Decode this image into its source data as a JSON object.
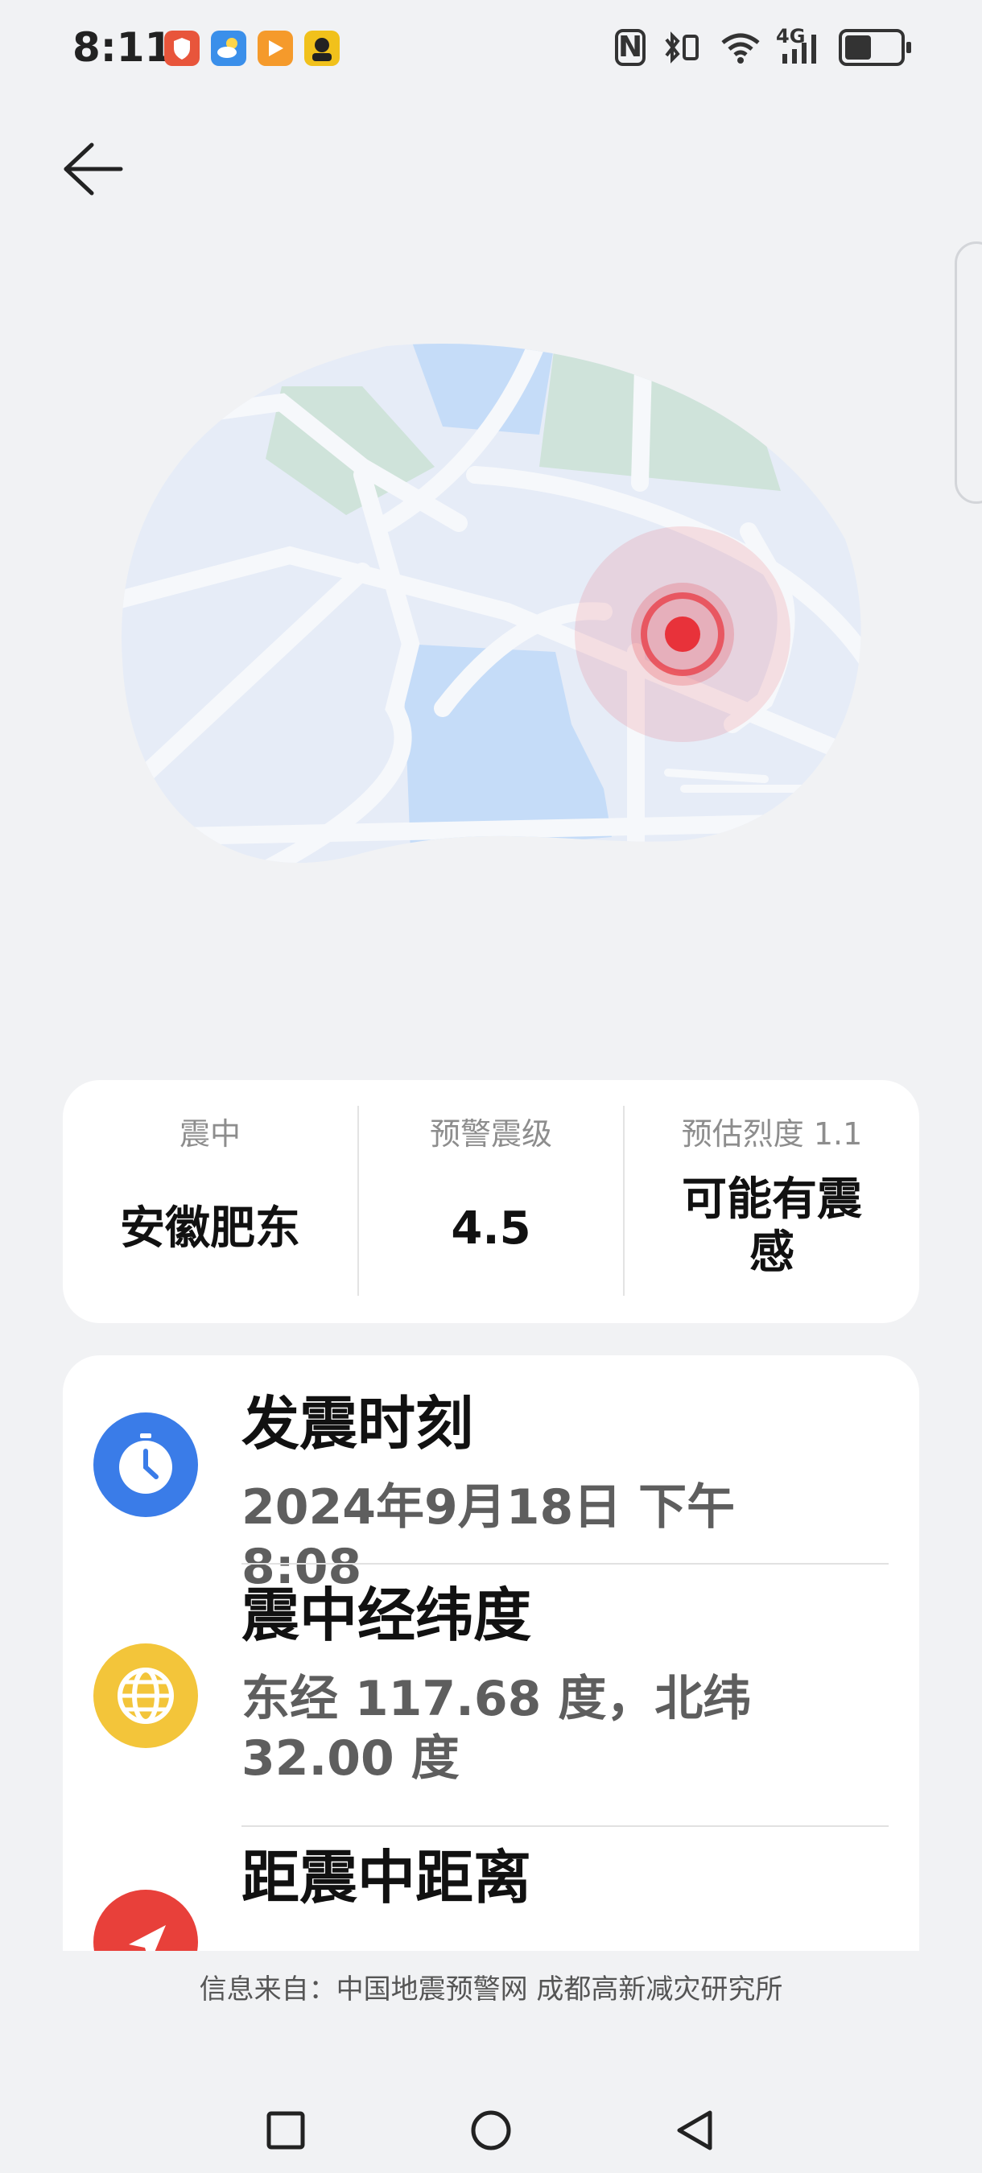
{
  "status_bar": {
    "time": "8:11",
    "app_icons": [
      {
        "name": "shield-app-icon",
        "color": "#e8553b"
      },
      {
        "name": "weather-app-icon",
        "color": "#3a8fea"
      },
      {
        "name": "video-app-icon",
        "color": "#f59a2b"
      },
      {
        "name": "avatar-app-icon",
        "color": "#f1c11b"
      }
    ],
    "network": "4G"
  },
  "summary": {
    "epicenter_label": "震中",
    "epicenter_value": "安徽肥东",
    "magnitude_label": "预警震级",
    "magnitude_value": "4.5",
    "intensity_label": "预估烈度 1.1",
    "intensity_value": "可能有震感"
  },
  "details": [
    {
      "title": "发震时刻",
      "value": "2024年9月18日 下午8:08",
      "icon": "clock-icon",
      "color": "#3a7ce8"
    },
    {
      "title": "震中经纬度",
      "value": "东经 117.68 度，北纬 32.00 度",
      "icon": "globe-icon",
      "color": "#f3c53a"
    },
    {
      "title": "距震中距离",
      "value": "",
      "icon": "navigation-arrow-icon",
      "color": "#e8403a"
    }
  ],
  "source_text": "信息来自：中国地震预警网 成都高新减灾研究所",
  "colors": {
    "background": "#f1f2f4",
    "epicenter_marker": "#e8323a",
    "map_land": "#e6ecf7",
    "map_water": "#c5dcf8",
    "map_park": "#cfe3da"
  }
}
